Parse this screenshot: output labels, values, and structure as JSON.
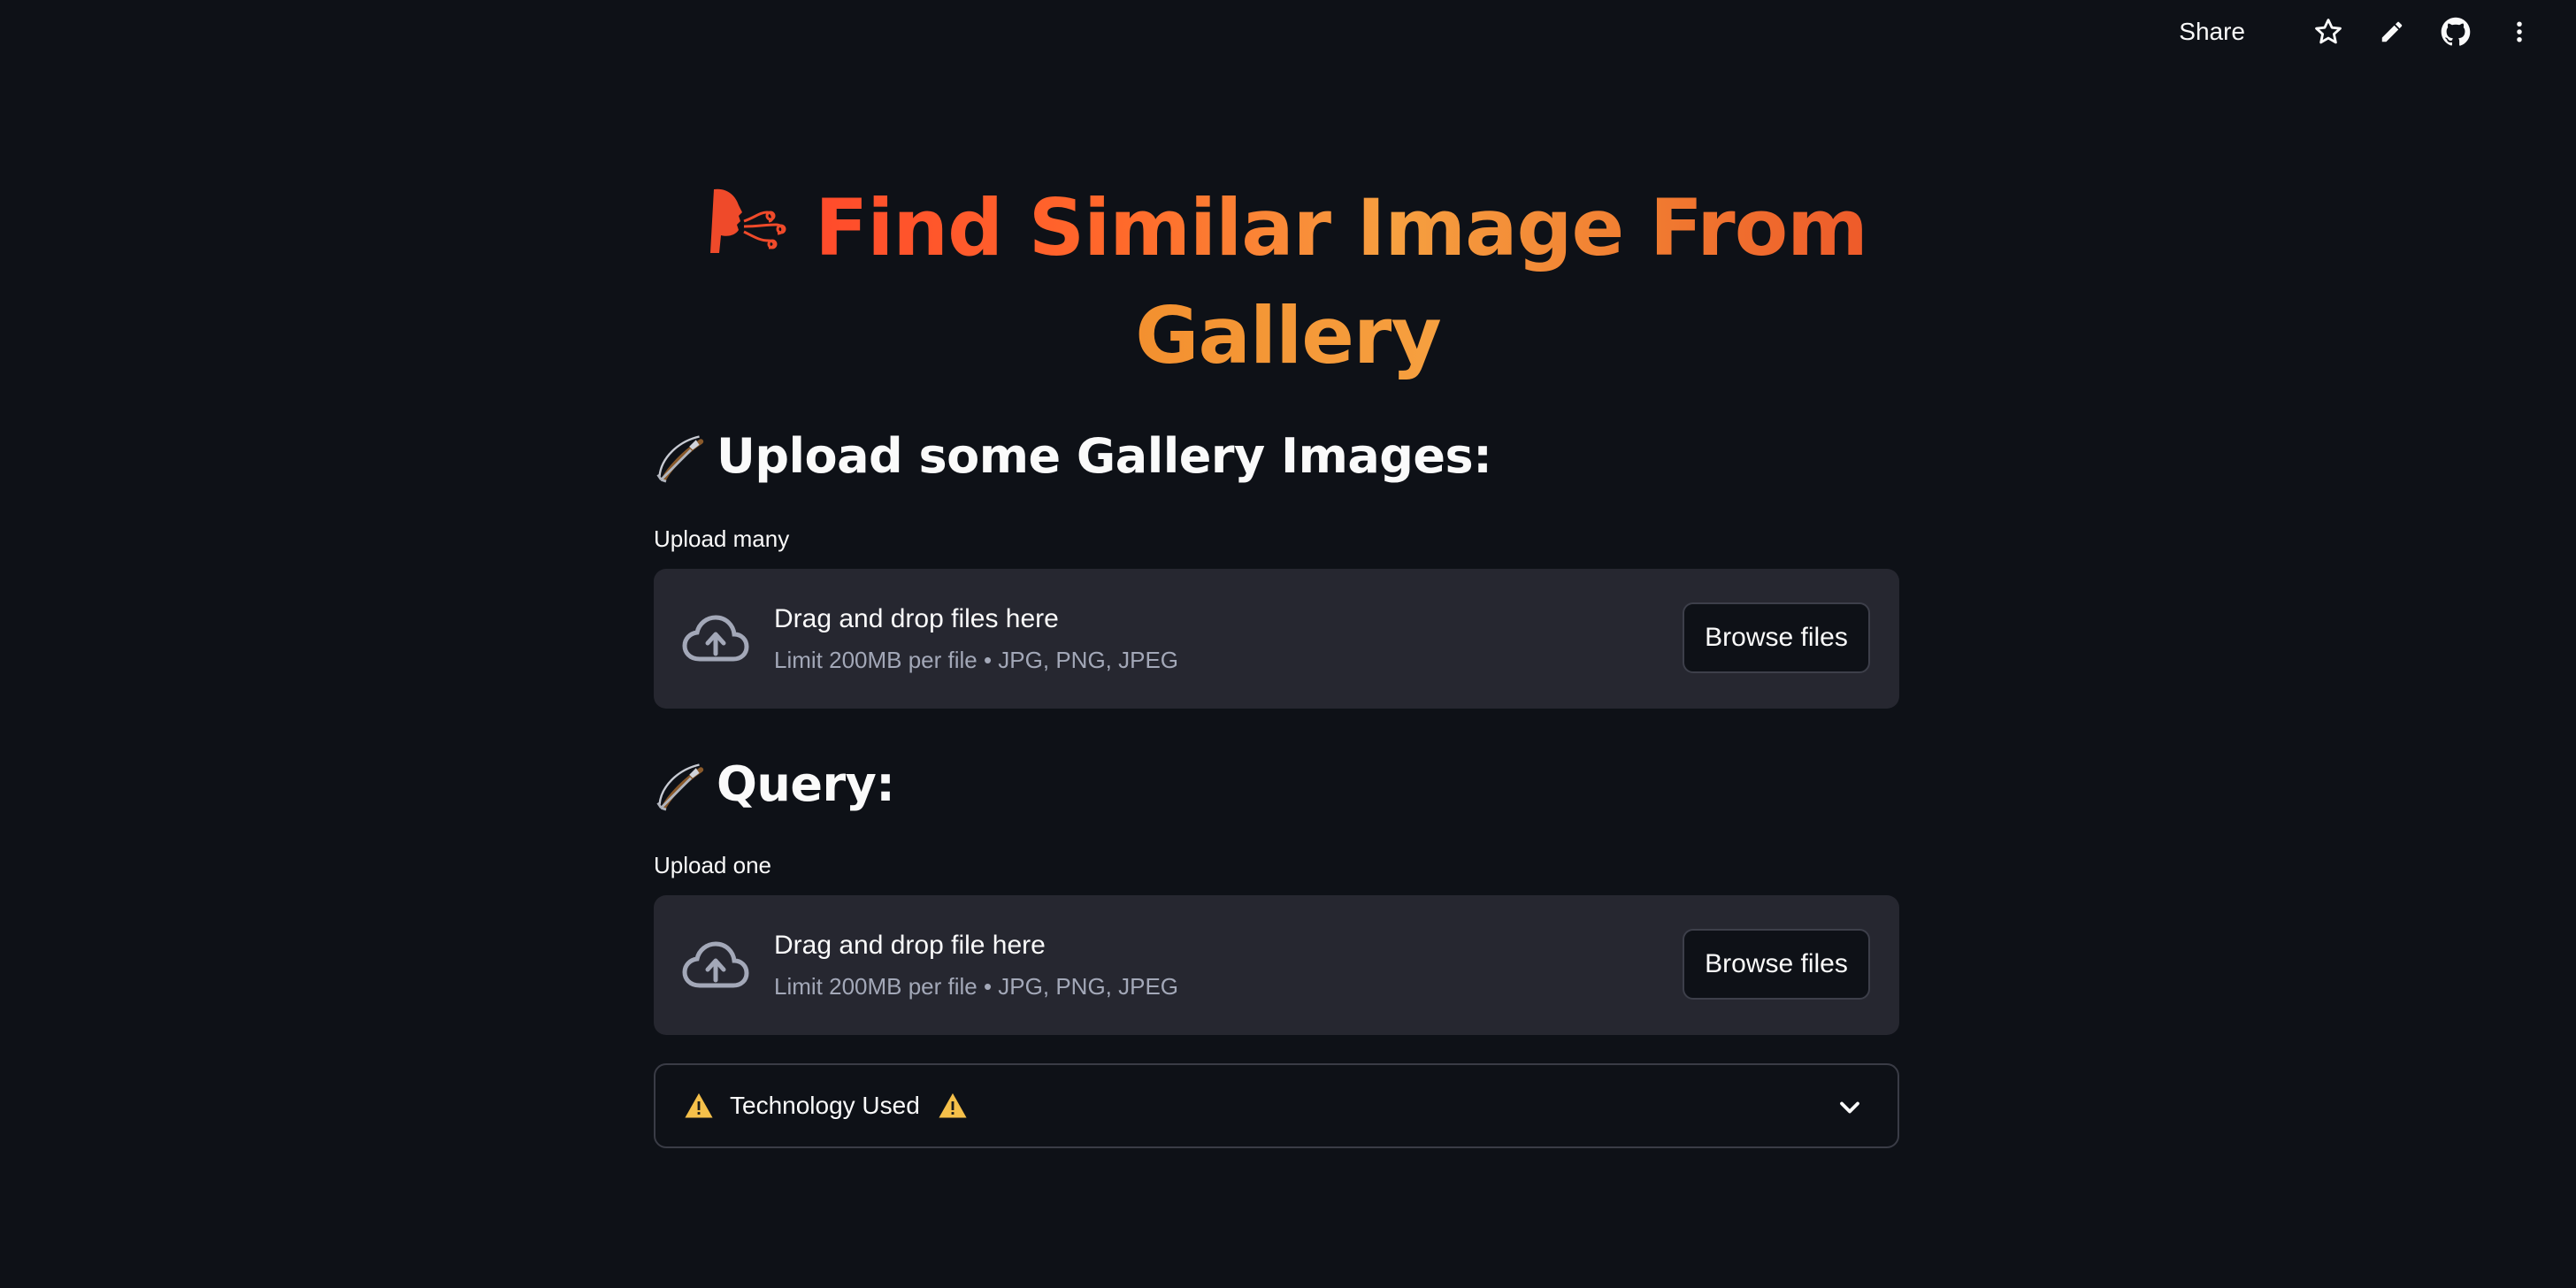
{
  "toolbar": {
    "share_label": "Share",
    "icons": [
      "star-icon",
      "pencil-icon",
      "github-icon",
      "more-vertical-icon"
    ]
  },
  "title": {
    "line1": "Find Similar Image From",
    "line2": "Gallery",
    "logo_icon": "face-breath-logo-icon"
  },
  "gallery_section": {
    "header": "Upload some Gallery Images:",
    "header_icon": "bow-and-arrow-icon",
    "uploader": {
      "label": "Upload many",
      "primary_text": "Drag and drop files here",
      "secondary_text": "Limit 200MB per file • JPG, PNG, JPEG",
      "button_label": "Browse files",
      "icon": "cloud-upload-icon"
    }
  },
  "query_section": {
    "header": "Query:",
    "header_icon": "bow-and-arrow-icon",
    "uploader": {
      "label": "Upload one",
      "primary_text": "Drag and drop file here",
      "secondary_text": "Limit 200MB per file • JPG, PNG, JPEG",
      "button_label": "Browse files",
      "icon": "cloud-upload-icon"
    }
  },
  "expander": {
    "label": "Technology Used",
    "icons": [
      "warning-icon",
      "warning-icon",
      "chevron-down-icon"
    ],
    "expanded": false
  },
  "colors": {
    "background": "#0e1117",
    "card": "#262730",
    "text": "#fafafa",
    "muted_text": "#a3a8b8",
    "title_gradient_start": "#ff4b2b",
    "title_gradient_mid": "#f6a040",
    "warning": "#f5c04a"
  }
}
